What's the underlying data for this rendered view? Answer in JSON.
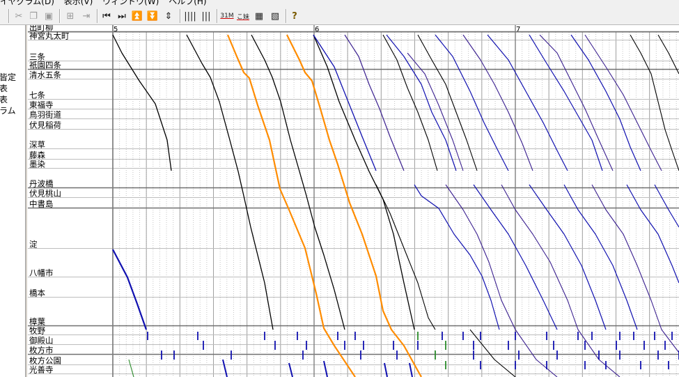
{
  "menu": [
    "イヤグラム(D)",
    "表示(V)",
    "ウィンドウ(W)",
    "ヘルプ(H)"
  ],
  "toolbar": {
    "label_31": "31M",
    "label_kana": "こ妹",
    "help_glyph": "?"
  },
  "left_panel": [
    "皆定",
    "表",
    "表",
    "ラム"
  ],
  "stations": [
    {
      "name": "出町柳",
      "major": true
    },
    {
      "name": "神宮丸太町",
      "major": false
    },
    {
      "name": "三条",
      "major": false
    },
    {
      "name": "祇園四条",
      "major": true
    },
    {
      "name": "清水五条",
      "major": false
    },
    {
      "name": "七条",
      "major": false
    },
    {
      "name": "東福寺",
      "major": false
    },
    {
      "name": "鳥羽街道",
      "major": false
    },
    {
      "name": "伏見稲荷",
      "major": false
    },
    {
      "name": "深草",
      "major": false
    },
    {
      "name": "藤森",
      "major": false
    },
    {
      "name": "墨染",
      "major": false
    },
    {
      "name": "丹波橋",
      "major": true
    },
    {
      "name": "伏見桃山",
      "major": false
    },
    {
      "name": "中書島",
      "major": true
    },
    {
      "name": "淀",
      "major": false
    },
    {
      "name": "八幡市",
      "major": false
    },
    {
      "name": "橋本",
      "major": false
    },
    {
      "name": "樟葉",
      "major": true
    },
    {
      "name": "牧野",
      "major": false
    },
    {
      "name": "御殿山",
      "major": false
    },
    {
      "name": "枚方市",
      "major": true
    },
    {
      "name": "枚方公園",
      "major": false
    },
    {
      "name": "光善寺",
      "major": false
    }
  ],
  "hours": [
    "5",
    "6",
    "7"
  ],
  "colors": {
    "local": "#000000",
    "express": "#ff8c00",
    "rapid": "#1010b0",
    "semi": "#3a1f8f",
    "green": "#2a8a2a",
    "grid": "#bdbdbd",
    "major_line": "#707070"
  }
}
